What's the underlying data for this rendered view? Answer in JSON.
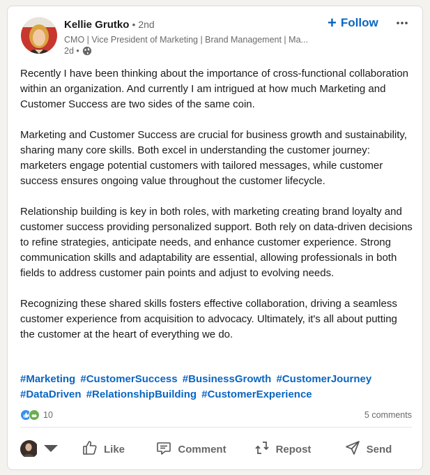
{
  "author": {
    "name": "Kellie Grutko",
    "degree": "• 2nd",
    "headline": "CMO | Vice President of Marketing | Brand Management | Ma...",
    "time": "2d •"
  },
  "follow_label": "Follow",
  "icons": {
    "follow": "plus-icon",
    "more": "more-options-icon",
    "visibility": "globe-icon",
    "like": "thumbs-up-icon",
    "comment": "comment-icon",
    "repost": "repost-icon",
    "send": "send-icon",
    "chevron": "chevron-down-icon"
  },
  "post": {
    "paragraphs": [
      "Recently I have been thinking about the importance of cross-functional collaboration within an organization. And currently I am intrigued at how much Marketing and Customer Success are two sides of the same coin.",
      "Marketing and Customer Success are crucial for business growth and sustainability, sharing many core skills. Both excel in understanding the customer journey: marketers engage potential customers with tailored messages, while customer success ensures ongoing value throughout the customer lifecycle.",
      "Relationship building is key in both roles, with marketing creating brand loyalty and customer success providing personalized support. Both rely on data-driven decisions to refine strategies, anticipate needs, and enhance customer experience. Strong communication skills and adaptability are essential, allowing professionals in both fields to address customer pain points and adjust to evolving needs.",
      "Recognizing these shared skills fosters effective collaboration, driving a seamless customer experience from acquisition to advocacy. Ultimately, it's all about putting the customer at the heart of everything we do."
    ],
    "hashtags": [
      "#Marketing",
      "#CustomerSuccess",
      "#BusinessGrowth",
      "#CustomerJourney",
      "#DataDriven",
      "#RelationshipBuilding",
      "#CustomerExperience"
    ]
  },
  "social": {
    "reaction_count": "10",
    "comments": "5 comments"
  },
  "actions": {
    "like": "Like",
    "comment": "Comment",
    "repost": "Repost",
    "send": "Send"
  },
  "colors": {
    "accent": "#0a66c2",
    "like_reaction": "#378fe9",
    "support_reaction": "#6dae4f"
  }
}
